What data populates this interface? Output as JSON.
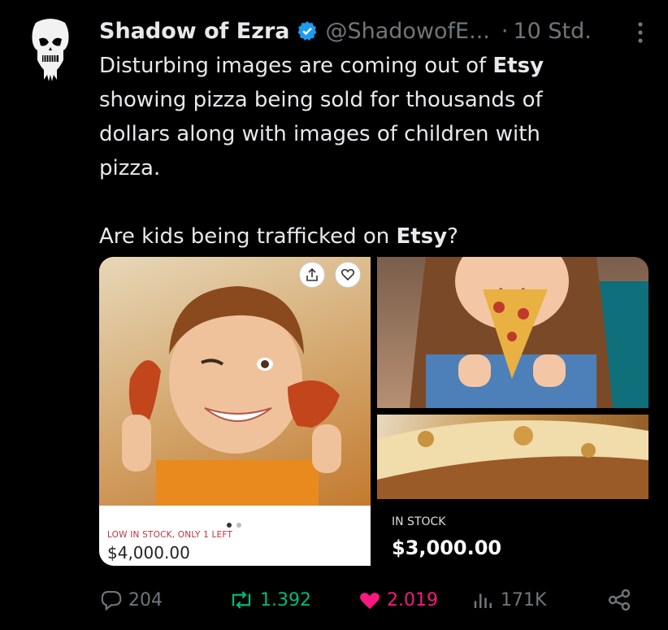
{
  "post": {
    "author": "Shadow of Ezra",
    "handle": "@ShadowofE...",
    "separator": "·",
    "time": "10 Std.",
    "text_line1": "Disturbing images are coming out of ",
    "text_bold1": "Etsy",
    "text_line2": "showing pizza being sold for thousands of dollars along with images of children with pizza.",
    "text_q_start": "Are kids being trafficked on ",
    "text_q_bold": "Etsy",
    "text_q_end": "?"
  },
  "media": {
    "left_stock": "LOW IN STOCK, ONLY 1 LEFT",
    "left_price": "$4,000.00",
    "right_stock": "IN STOCK",
    "right_price": "$3,000.00"
  },
  "actions": {
    "replies": "204",
    "reposts": "1.392",
    "likes": "2.019",
    "views": "171K"
  },
  "colors": {
    "repost": "#00ba7c",
    "like": "#f91880",
    "verified": "#1d9bf0",
    "muted": "#71767b"
  },
  "icons": [
    "punisher-skull-avatar",
    "verified-badge-icon",
    "more-icon",
    "share-icon",
    "heart-icon",
    "reply-icon",
    "repost-icon",
    "like-icon",
    "views-icon",
    "share-network-icon"
  ]
}
